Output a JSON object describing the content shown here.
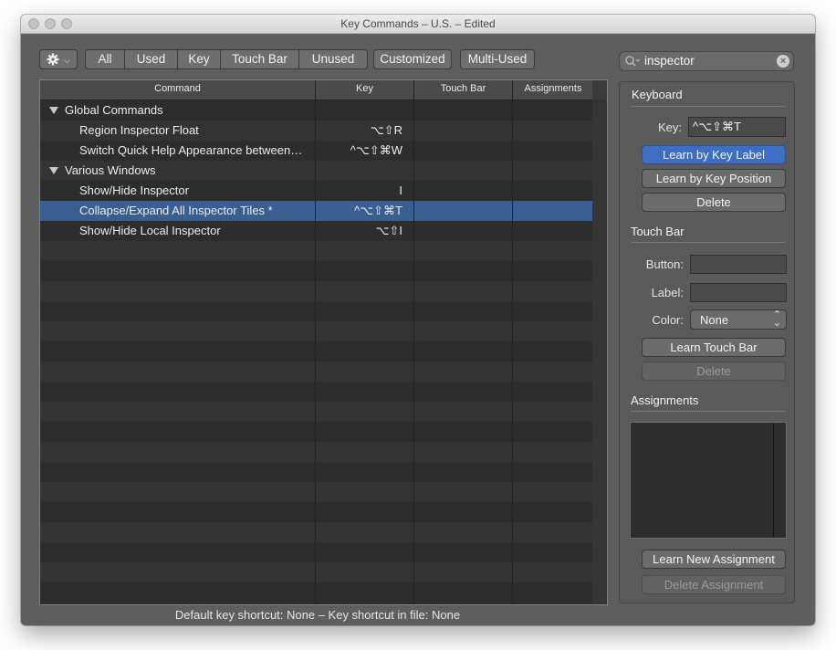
{
  "window": {
    "title": "Key Commands – U.S. – Edited"
  },
  "toolbar": {
    "gear_icon": "gear-icon",
    "filters": [
      "All",
      "Used",
      "Key",
      "Touch Bar",
      "Unused"
    ],
    "customized_label": "Customized",
    "multi_used_label": "Multi-Used"
  },
  "search": {
    "value": "inspector",
    "icon": "magnifier-icon",
    "clear_icon": "clear-icon"
  },
  "table": {
    "columns": [
      "Command",
      "Key",
      "Touch Bar",
      "Assignments"
    ],
    "rows": [
      {
        "command": "Global Commands",
        "key": "",
        "group": true
      },
      {
        "command": "Region Inspector Float",
        "key": "⌥⇧R",
        "group": false
      },
      {
        "command": "Switch Quick Help Appearance between…",
        "key": "^⌥⇧⌘W",
        "group": false
      },
      {
        "command": "Various Windows",
        "key": "",
        "group": true
      },
      {
        "command": "Show/Hide Inspector",
        "key": "I",
        "group": false
      },
      {
        "command": "Collapse/Expand All Inspector Tiles *",
        "key": "^⌥⇧⌘T",
        "group": false,
        "selected": true
      },
      {
        "command": "Show/Hide Local Inspector",
        "key": "⌥⇧I",
        "group": false
      }
    ]
  },
  "panel": {
    "keyboard": {
      "heading": "Keyboard",
      "key_label": "Key:",
      "key_value": "^⌥⇧⌘T",
      "learn_key_label": "Learn by Key Label",
      "learn_key_position": "Learn by Key Position",
      "delete": "Delete"
    },
    "touchbar": {
      "heading": "Touch Bar",
      "button_label": "Button:",
      "label_label": "Label:",
      "color_label": "Color:",
      "color_value": "None",
      "learn": "Learn Touch Bar",
      "delete": "Delete"
    },
    "assignments": {
      "heading": "Assignments",
      "learn_new": "Learn New Assignment",
      "delete": "Delete Assignment"
    }
  },
  "status": {
    "text": "Default key shortcut: None – Key shortcut in file: None"
  },
  "colors": {
    "selection": "#3b5e91",
    "accent_button": "#3d6ec4"
  }
}
